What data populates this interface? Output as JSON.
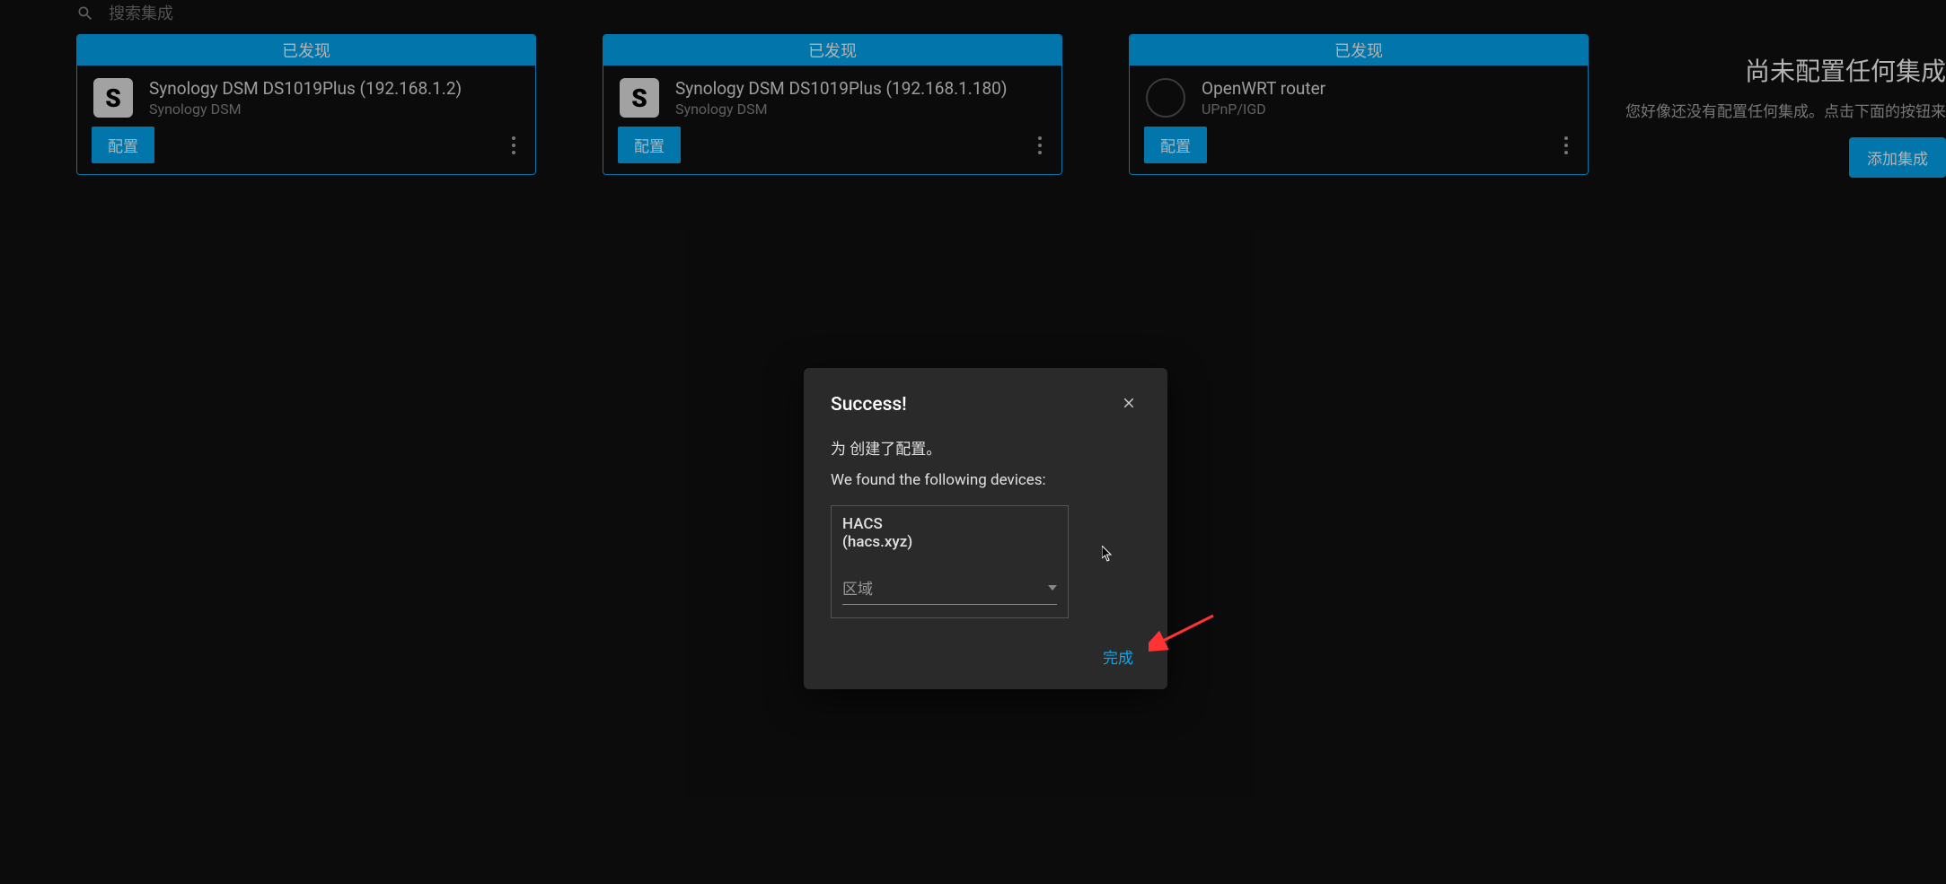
{
  "search": {
    "placeholder": "搜索集成"
  },
  "cards": [
    {
      "header": "已发现",
      "icon_text": "S",
      "icon_type": "letter",
      "title": "Synology DSM DS1019Plus (192.168.1.2)",
      "subtitle": "Synology DSM",
      "config_label": "配置"
    },
    {
      "header": "已发现",
      "icon_text": "S",
      "icon_type": "letter",
      "title": "Synology DSM DS1019Plus (192.168.1.180)",
      "subtitle": "Synology DSM",
      "config_label": "配置"
    },
    {
      "header": "已发现",
      "icon_text": "",
      "icon_type": "router",
      "title": "OpenWRT router",
      "subtitle": "UPnP/IGD",
      "config_label": "配置"
    }
  ],
  "right_panel": {
    "title": "尚未配置任何集成",
    "subtitle": "您好像还没有配置任何集成。点击下面的按钮来",
    "add_label": "添加集成"
  },
  "modal": {
    "title": "Success!",
    "line1": "为 创建了配置。",
    "line2": "We found the following devices:",
    "device_name": "HACS",
    "device_domain": "(hacs.xyz)",
    "area_label": "区域",
    "done_label": "完成"
  }
}
